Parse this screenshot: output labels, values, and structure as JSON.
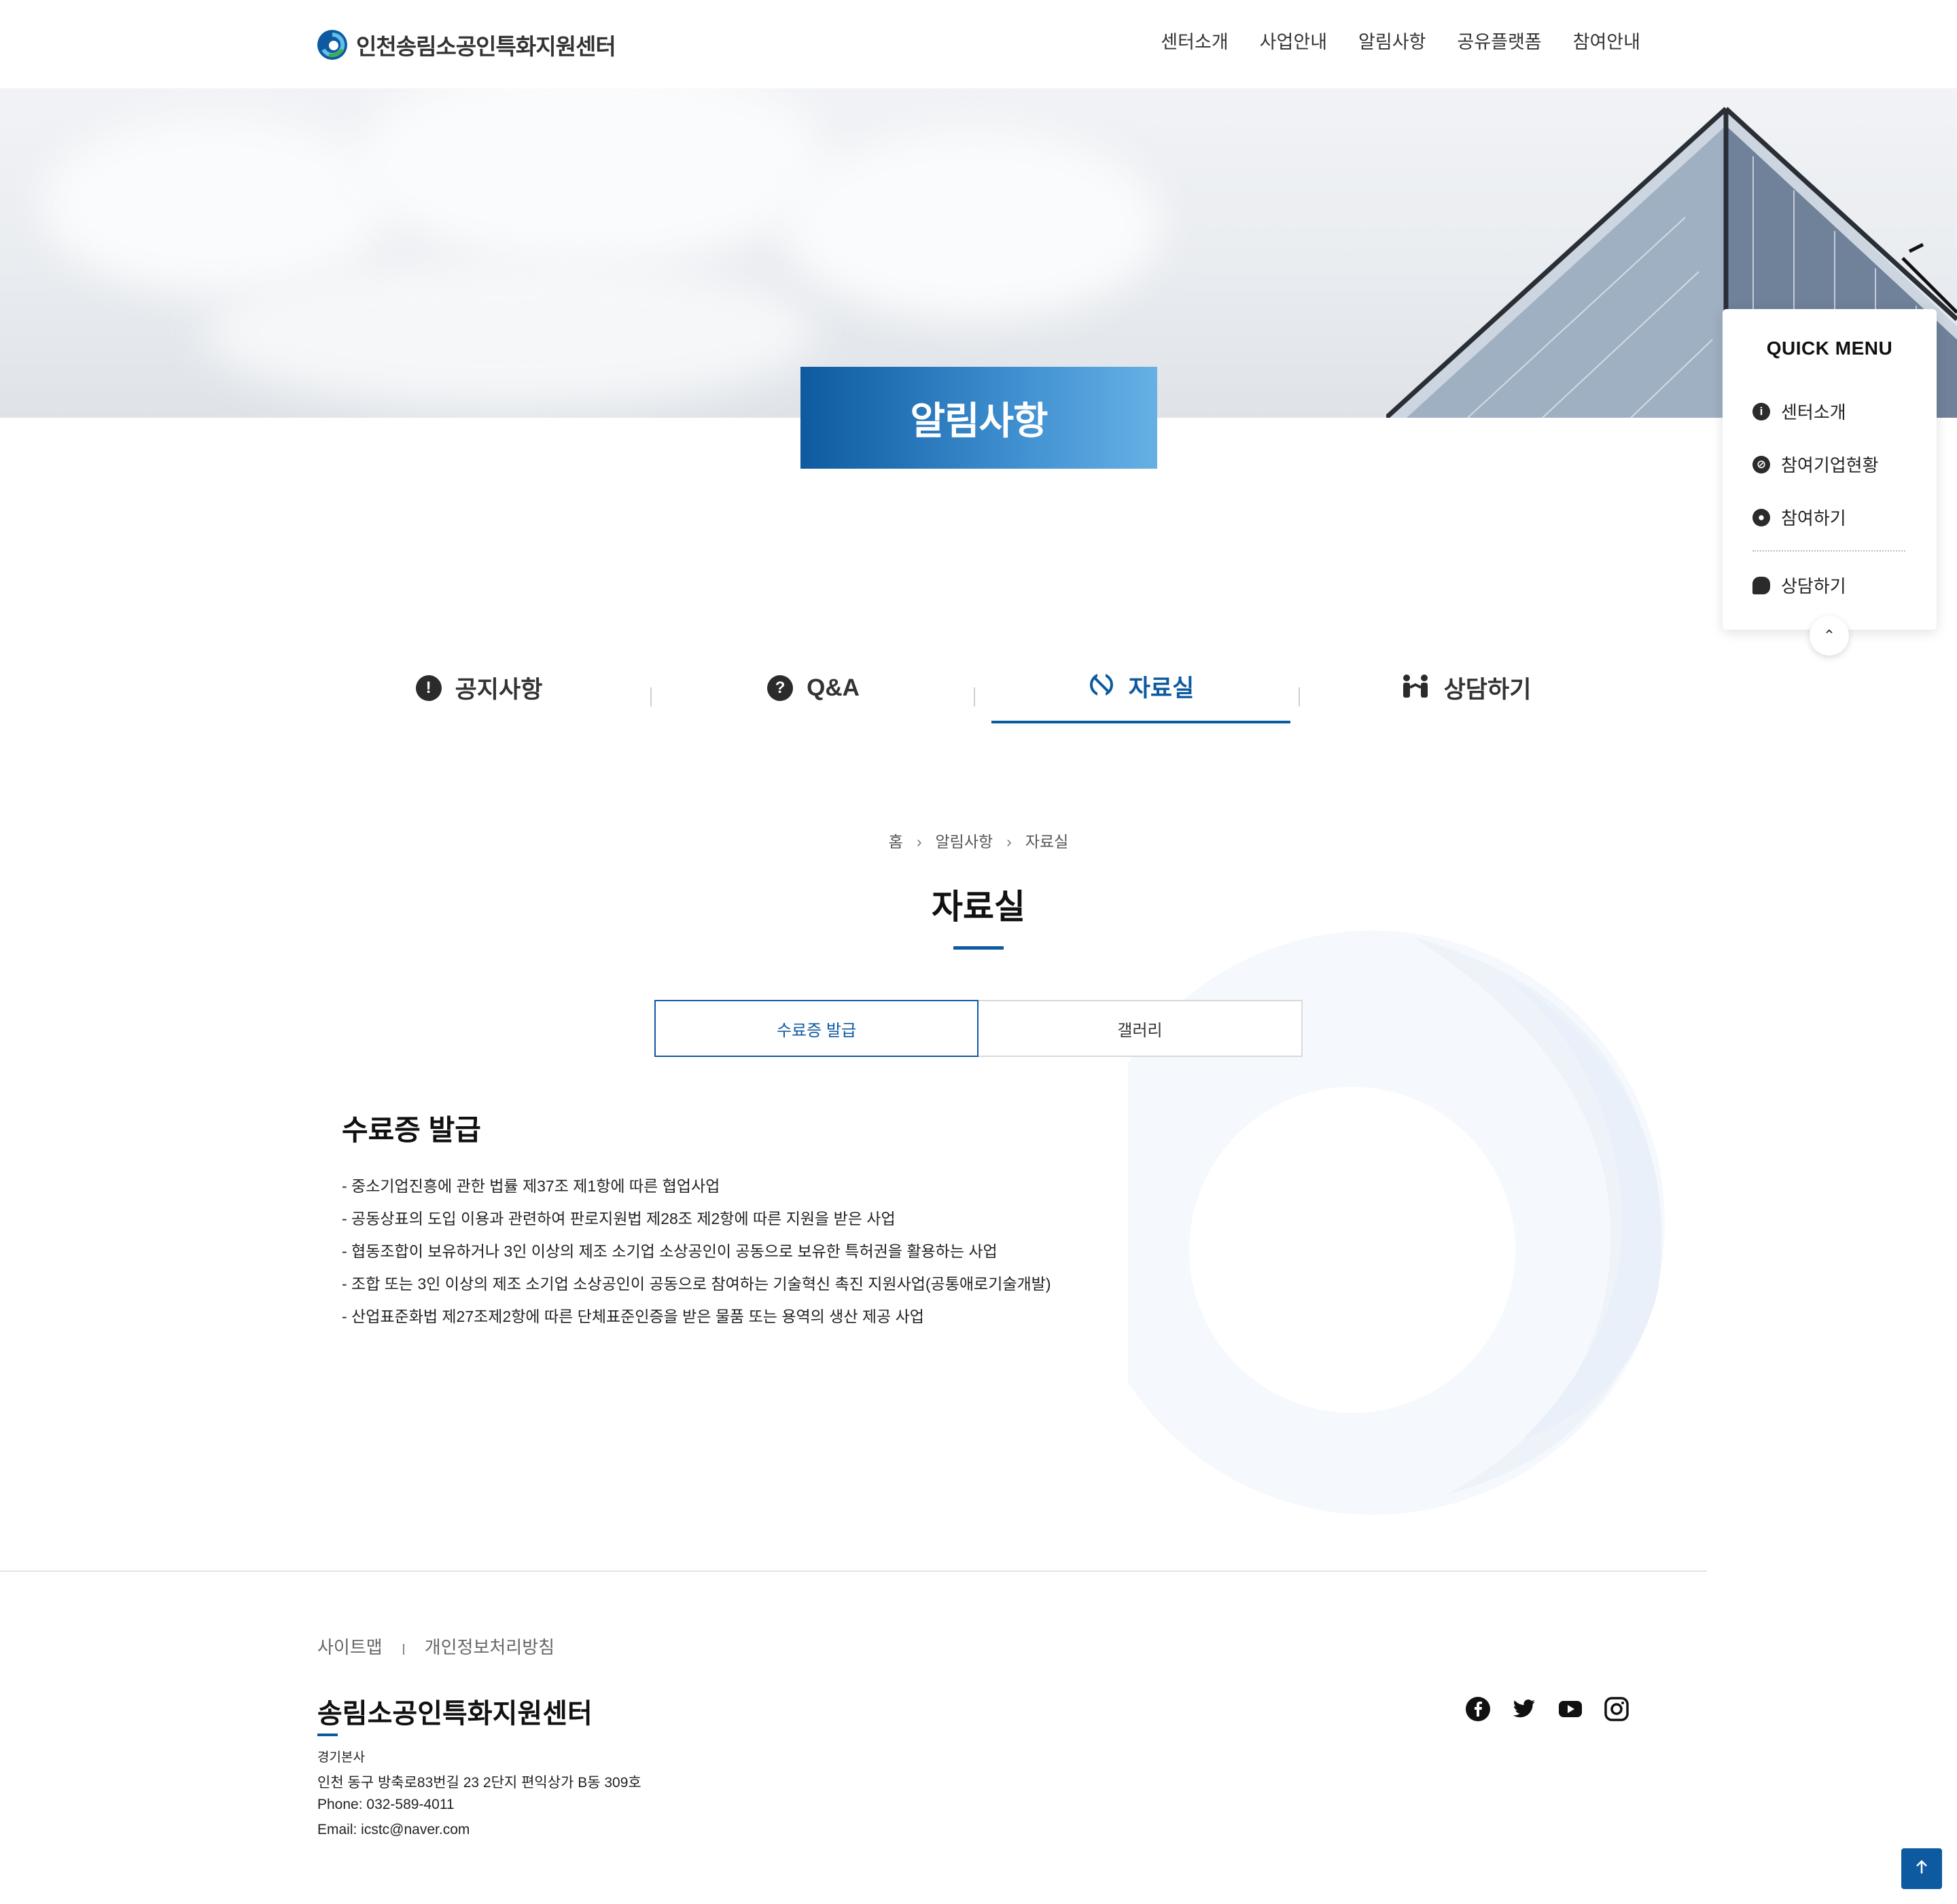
{
  "header": {
    "logo_text": "인천송림소공인특화지원센터",
    "nav": [
      "센터소개",
      "사업안내",
      "알림사항",
      "공유플랫폼",
      "참여안내"
    ]
  },
  "banner": {
    "title": "알림사항"
  },
  "quick_menu": {
    "title": "QUICK MENU",
    "items": [
      {
        "label": "센터소개",
        "icon": "info-icon"
      },
      {
        "label": "참여기업현황",
        "icon": "link-icon"
      },
      {
        "label": "참여하기",
        "icon": "user-icon"
      },
      {
        "label": "상담하기",
        "icon": "chat-icon"
      }
    ]
  },
  "tabs": [
    {
      "label": "공지사항",
      "icon": "exclamation-icon",
      "active": false
    },
    {
      "label": "Q&A",
      "icon": "question-icon",
      "active": false
    },
    {
      "label": "자료실",
      "icon": "archive-icon",
      "active": true
    },
    {
      "label": "상담하기",
      "icon": "handshake-icon",
      "active": false
    }
  ],
  "breadcrumb": [
    "홈",
    "알림사항",
    "자료실"
  ],
  "page_title": "자료실",
  "subtabs": [
    {
      "label": "수료증 발급",
      "active": true
    },
    {
      "label": "갤러리",
      "active": false
    }
  ],
  "content": {
    "title": "수료증 발급",
    "items": [
      "- 중소기업진흥에 관한 법률 제37조 제1항에 따른 협업사업",
      "- 공동상표의 도입 이용과 관련하여 판로지원법 제28조 제2항에 따른 지원을 받은 사업",
      "- 협동조합이 보유하거나 3인 이상의 제조 소기업 소상공인이 공동으로 보유한 특허권을 활용하는 사업",
      "- 조합 또는 3인 이상의 제조 소기업 소상공인이 공동으로 참여하는 기술혁신 촉진 지원사업(공통애로기술개발)",
      "- 산업표준화법 제27조제2항에 따른 단체표준인증을 받은 물품 또는 용역의 생산 제공 사업"
    ]
  },
  "footer": {
    "links": [
      "사이트맵",
      "개인정보처리방침"
    ],
    "name": "송림소공인특화지원센터",
    "branch": "경기본사",
    "address": "인천 동구 방축로83번길 23 2단지 편익상가 B동 309호",
    "phone": "Phone: 032-589-4011",
    "email": "Email: icstc@naver.com",
    "sns": [
      "facebook-icon",
      "twitter-icon",
      "youtube-icon",
      "instagram-icon"
    ]
  },
  "colors": {
    "brand": "#0d5aa0",
    "banner_light": "#66b0e4"
  }
}
